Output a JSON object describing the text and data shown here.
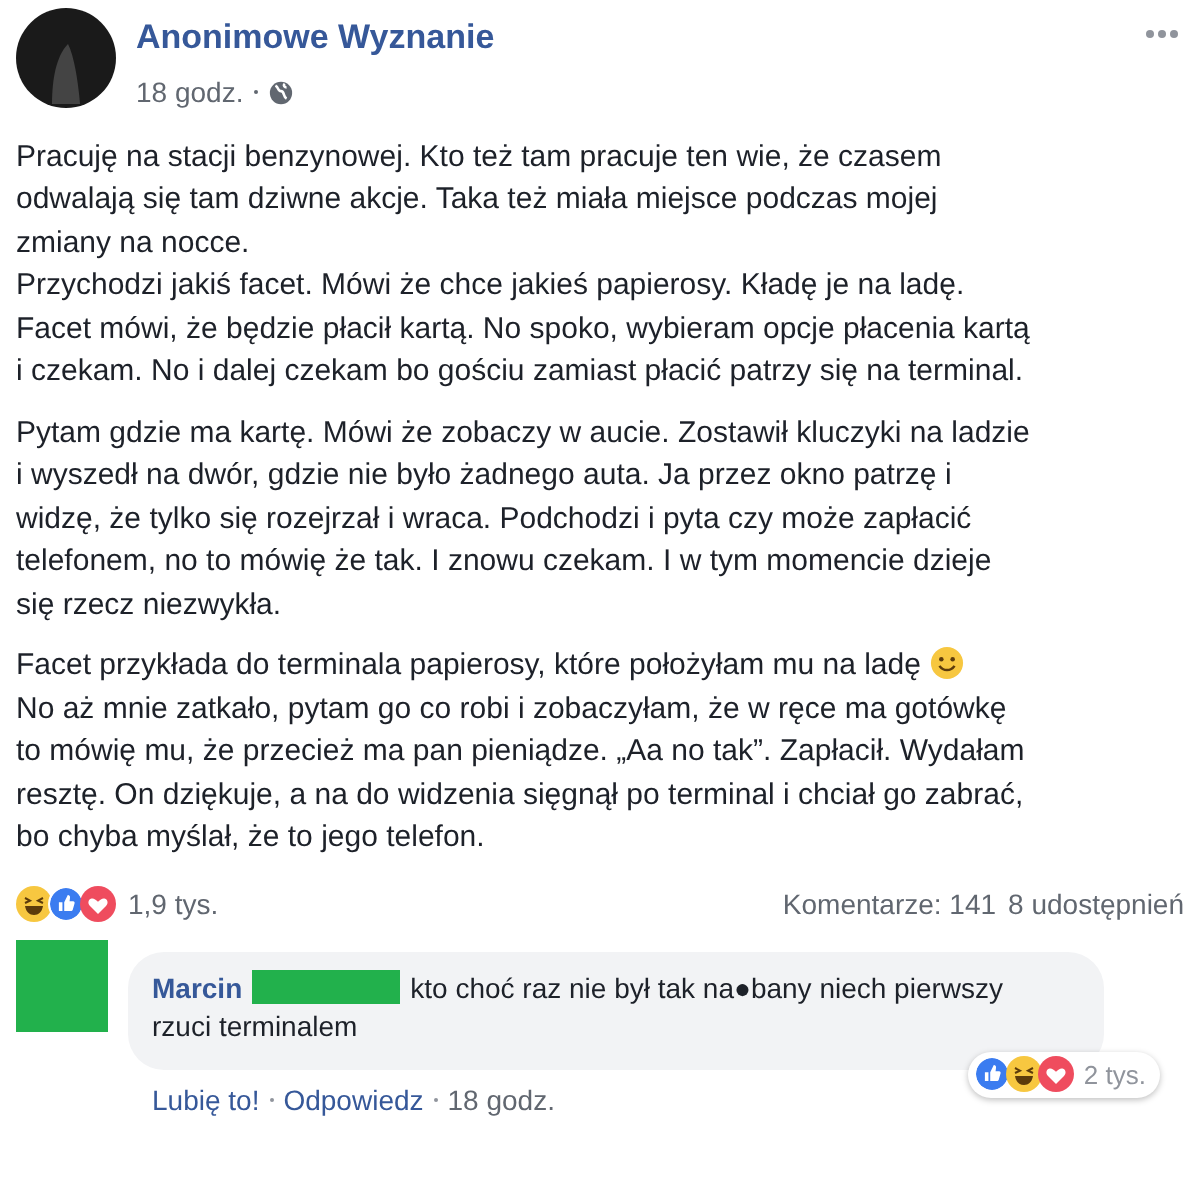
{
  "post": {
    "author": "Anonimowe Wyznanie",
    "time": "18 godz.",
    "paragraphs": [
      {
        "text": "Pracuję na stacji benzynowej. Kto też tam pracuje ten wie, że czasem\nodwalają się tam dziwne akcje. Taka też miała miejsce podczas mojej\nzmiany na nocce.\nPrzychodzi jakiś facet. Mówi że chce jakieś papierosy. Kładę je na ladę.\nFacet mówi, że będzie płacił kartą. No spoko, wybieram opcje płacenia kartą\ni czekam. No i dalej czekam bo gościu zamiast płacić patrzy się na terminal."
      },
      {
        "text": "Pytam gdzie ma kartę. Mówi że zobaczy w aucie. Zostawił kluczyki na ladzie\ni wyszedł na dwór, gdzie nie było żadnego auta. Ja przez okno patrzę i\nwidzę, że tylko się rozejrzał i wraca. Podchodzi i pyta czy może zapłacić\ntelefonem, no to mówię że tak. I znowu czekam. I w tym momencie dzieje\nsię rzecz niezwykła."
      },
      {
        "text": "Facet przykłada do terminala papierosy, które położyłam mu na ladę",
        "smiley": true,
        "text_after": "No aż mnie zatkało, pytam go co robi i zobaczyłam, że w ręce ma gotówkę\nto mówię mu, że przecież ma pan pieniądze. „Aa no tak”. Zapłacił. Wydałam\nresztę. On dziękuje, a na do widzenia sięgnął po terminal i chciał go zabrać,\nbo chyba myślał, że to jego telefon."
      }
    ],
    "reactions": {
      "count": "1,9 tys.",
      "comments": "Komentarze: 141",
      "shares": "8 udostępnień"
    }
  },
  "comment": {
    "author": "Marcin",
    "text": "kto choć raz nie był tak na●bany niech pierwszy\nrzuci terminalem",
    "reactions_count": "2 tys.",
    "actions": [
      "Lubię to!",
      "Odpowiedz"
    ],
    "time": "18 godz."
  }
}
